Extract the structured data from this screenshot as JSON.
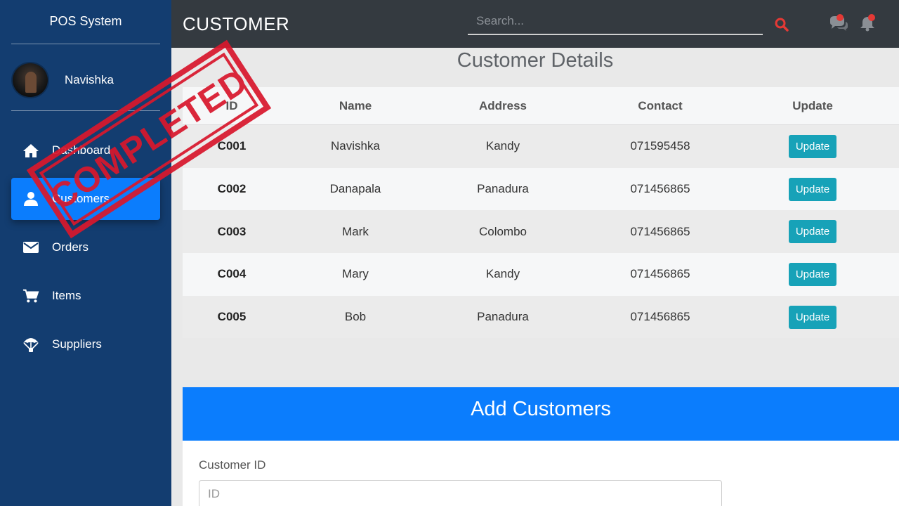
{
  "sidebar": {
    "brand": "POS System",
    "user_name": "Navishka",
    "items": [
      {
        "label": "Dashboard",
        "icon": "home-icon",
        "active": false
      },
      {
        "label": "Customers",
        "icon": "user-icon",
        "active": true
      },
      {
        "label": "Orders",
        "icon": "envelope-icon",
        "active": false
      },
      {
        "label": "Items",
        "icon": "cart-icon",
        "active": false
      },
      {
        "label": "Suppliers",
        "icon": "parachute-icon",
        "active": false
      }
    ]
  },
  "header": {
    "title": "CUSTOMER",
    "search_placeholder": "Search..."
  },
  "main": {
    "section_title": "Customer Details",
    "columns": [
      "ID",
      "Name",
      "Address",
      "Contact",
      "Update"
    ],
    "rows": [
      {
        "id": "C001",
        "name": "Navishka",
        "address": "Kandy",
        "contact": "071595458",
        "action": "Update"
      },
      {
        "id": "C002",
        "name": "Danapala",
        "address": "Panadura",
        "contact": "071456865",
        "action": "Update"
      },
      {
        "id": "C003",
        "name": "Mark",
        "address": "Colombo",
        "contact": "071456865",
        "action": "Update"
      },
      {
        "id": "C004",
        "name": "Mary",
        "address": "Kandy",
        "contact": "071456865",
        "action": "Update"
      },
      {
        "id": "C005",
        "name": "Bob",
        "address": "Panadura",
        "contact": "071456865",
        "action": "Update"
      }
    ]
  },
  "add_form": {
    "title": "Add Customers",
    "customer_id_label": "Customer ID",
    "customer_id_placeholder": "ID"
  },
  "stamp": {
    "text": "COMPLETED"
  },
  "colors": {
    "sidebar_bg": "#133d70",
    "topbar_bg": "#343a40",
    "accent_blue": "#0b7dfd",
    "update_button": "#17a2b8",
    "stamp_red": "#d8182d",
    "notification_red": "#e53935"
  }
}
